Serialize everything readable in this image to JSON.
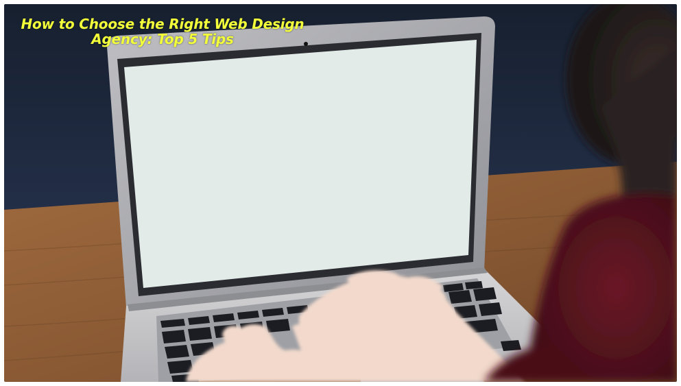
{
  "overlay": {
    "title_line1": "How to Choose the Right Web Design",
    "title_line2": "Agency: Top 5 Tips"
  },
  "colors": {
    "title": "#f2ff3a",
    "wall": "#1f2b3f",
    "desk": "#8a5a34",
    "screen": "#e3ebe8",
    "laptop_body": "#c9c9cb",
    "keys": "#1b1d23",
    "hand": "#f2d9cc",
    "sweater": "#5a1420"
  }
}
